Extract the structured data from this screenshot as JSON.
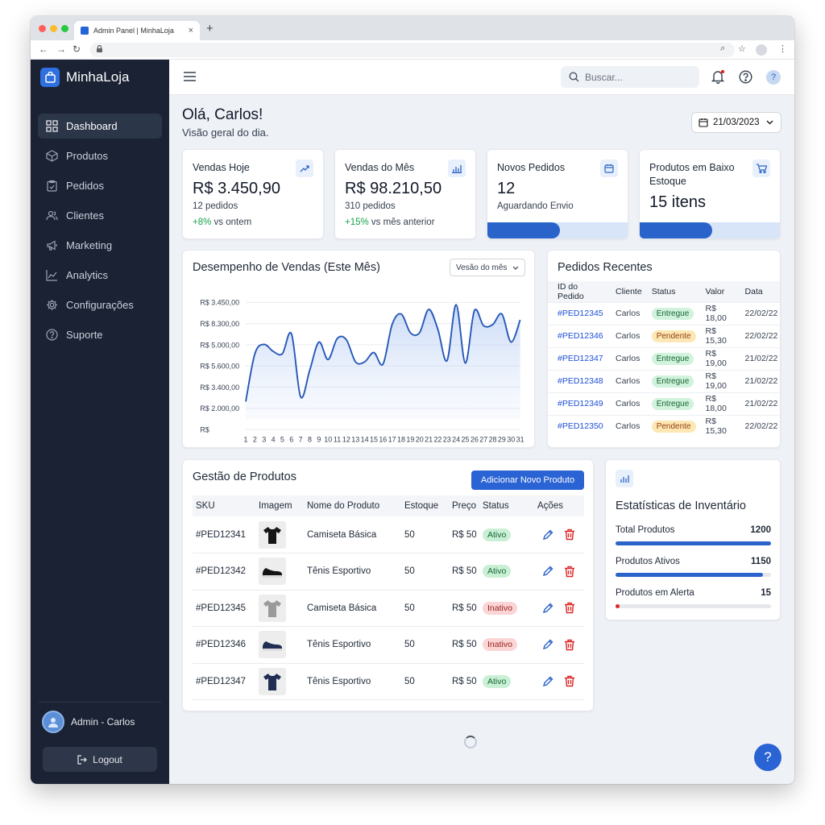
{
  "browser": {
    "tab_title": "Admin Panel | MinhaLoja",
    "close": "×",
    "new_tab": "+",
    "back": "←",
    "forward": "→",
    "reload": "↻",
    "lock": "🔒",
    "zoom": "⌕",
    "star": "☆",
    "menu": "⋮"
  },
  "sidebar": {
    "brand": "MinhaLoja",
    "items": [
      {
        "label": "Dashboard"
      },
      {
        "label": "Produtos"
      },
      {
        "label": "Pedidos"
      },
      {
        "label": "Clientes"
      },
      {
        "label": "Marketing"
      },
      {
        "label": "Analytics"
      },
      {
        "label": "Configurações"
      },
      {
        "label": "Suporte"
      }
    ],
    "user": "Admin - Carlos",
    "logout": "Logout"
  },
  "topbar": {
    "search_placeholder": "Buscar..."
  },
  "header": {
    "greeting": "Olá, Carlos!",
    "subtitle": "Visão geral do dia.",
    "date": "21/03/2023"
  },
  "stats": [
    {
      "title": "Vendas Hoje",
      "value": "R$ 3.450,90",
      "sub": "12 pedidos",
      "trend": "+8%",
      "trend_text": " vs ontem"
    },
    {
      "title": "Vendas do Mês",
      "value": "R$ 98.210,50",
      "sub": "310 pedidos",
      "trend": "+15%",
      "trend_text": " vs mês anterior"
    },
    {
      "title": "Novos Pedidos",
      "value": "12",
      "sub": "Aguardando Envio",
      "progress": 0.52
    },
    {
      "title": "Produtos em Baixo Estoque",
      "value": "15 itens",
      "progress": 0.52
    }
  ],
  "sales_chart": {
    "title": "Desempenho de Vendas (Este Mês)",
    "select": "Vesão do mês",
    "y_tick_labels": [
      "R$ 3.450,00",
      "R$ 8.300,00",
      "R$ 5.000,00",
      "R$ 5.600,00",
      "R$ 3.400,00",
      "R$ 2.000,00",
      "R$"
    ],
    "chart_data": {
      "type": "area",
      "x": [
        1,
        2,
        3,
        4,
        5,
        6,
        7,
        8,
        9,
        10,
        11,
        12,
        13,
        14,
        15,
        16,
        17,
        18,
        19,
        20,
        21,
        22,
        23,
        24,
        25,
        26,
        27,
        28,
        29,
        30,
        31
      ],
      "values": [
        0.85,
        0.44,
        0.36,
        0.42,
        0.44,
        0.27,
        0.81,
        0.58,
        0.34,
        0.49,
        0.31,
        0.32,
        0.51,
        0.51,
        0.43,
        0.53,
        0.19,
        0.1,
        0.26,
        0.26,
        0.06,
        0.23,
        0.5,
        0.02,
        0.52,
        0.07,
        0.2,
        0.19,
        0.1,
        0.34,
        0.15
      ],
      "note_scale": "values normalized top-down where 0 is top gridline",
      "title": "Desempenho de Vendas (Este Mês)"
    }
  },
  "orders": {
    "title": "Pedidos Recentes",
    "columns": [
      "ID do Pedido",
      "Cliente",
      "Status",
      "Valor",
      "Data"
    ],
    "rows": [
      {
        "id": "#PED12345",
        "client": "Carlos",
        "status": "Entregue",
        "value": "R$ 18,00",
        "date": "22/02/22"
      },
      {
        "id": "#PED12346",
        "client": "Carlos",
        "status": "Pendente",
        "value": "R$ 15,30",
        "date": "22/02/22"
      },
      {
        "id": "#PED12347",
        "client": "Carlos",
        "status": "Entregue",
        "value": "R$ 19,00",
        "date": "21/02/22"
      },
      {
        "id": "#PED12348",
        "client": "Carlos",
        "status": "Entregue",
        "value": "R$ 19,00",
        "date": "21/02/22"
      },
      {
        "id": "#PED12349",
        "client": "Carlos",
        "status": "Entregue",
        "value": "R$ 18,00",
        "date": "21/02/22"
      },
      {
        "id": "#PED12350",
        "client": "Carlos",
        "status": "Pendente",
        "value": "R$ 15,30",
        "date": "22/02/22"
      }
    ]
  },
  "products": {
    "title": "Gestão de Produtos",
    "add_button": "Adicionar Novo Produto",
    "columns": [
      "SKU",
      "Imagem",
      "Nome do Produto",
      "Estoque",
      "Preço",
      "Status",
      "Ações"
    ],
    "rows": [
      {
        "sku": "#PED12341",
        "img": "tshirt-black",
        "name": "Camiseta Básica",
        "stock": "50",
        "price": "R$ 50",
        "status": "Ativo"
      },
      {
        "sku": "#PED12342",
        "img": "sneaker-black",
        "name": "Tênis Esportivo",
        "stock": "50",
        "price": "R$ 50",
        "status": "Ativo"
      },
      {
        "sku": "#PED12345",
        "img": "tshirt-gray",
        "name": "Camiseta Básica",
        "stock": "50",
        "price": "R$ 50",
        "status": "Inativo"
      },
      {
        "sku": "#PED12346",
        "img": "sneaker-navy",
        "name": "Tênis Esportivo",
        "stock": "50",
        "price": "R$ 50",
        "status": "Inativo"
      },
      {
        "sku": "#PED12347",
        "img": "tshirt-navy",
        "name": "Tênis Esportivo",
        "stock": "50",
        "price": "R$ 50",
        "status": "Ativo"
      }
    ]
  },
  "inventory": {
    "title": "Estatísticas de Inventário",
    "rows": [
      {
        "label": "Total Produtos",
        "value": "1200",
        "fraction": 1.0,
        "color": "#2a63c9"
      },
      {
        "label": "Produtos Ativos",
        "value": "1150",
        "fraction": 0.95,
        "color": "#2a63c9"
      },
      {
        "label": "Produtos em Alerta",
        "value": "15",
        "fraction": 0.02,
        "color": "#dc2626"
      }
    ]
  },
  "help": "?"
}
